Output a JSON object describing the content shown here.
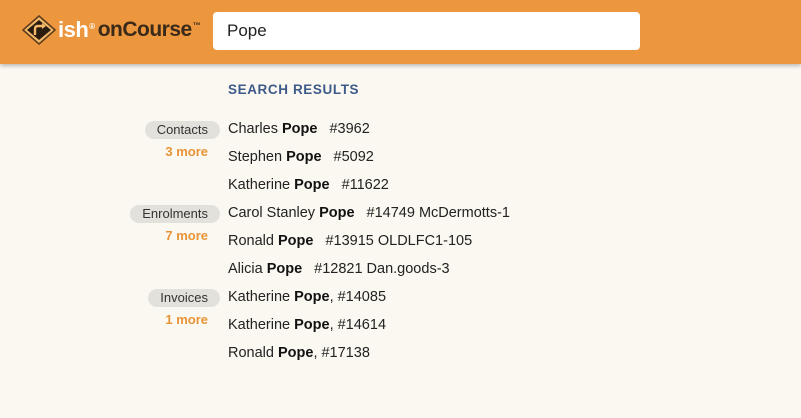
{
  "header": {
    "logo_ish": "ish",
    "logo_reg": "®",
    "logo_oncourse": "onCourse",
    "logo_tm": "™",
    "search_value": "Pope"
  },
  "results_heading": "SEARCH RESULTS",
  "groups": [
    {
      "label": "Contacts",
      "more": "3 more",
      "items": [
        {
          "pre": "Charles ",
          "match": "Pope",
          "post": "",
          "id": "#3962"
        },
        {
          "pre": "Stephen ",
          "match": "Pope",
          "post": "",
          "id": "#5092"
        },
        {
          "pre": "Katherine ",
          "match": "Pope",
          "post": "",
          "id": "#11622"
        }
      ]
    },
    {
      "label": "Enrolments",
      "more": "7 more",
      "items": [
        {
          "pre": "Carol Stanley ",
          "match": "Pope",
          "post": "",
          "id": "#14749 McDermotts-1"
        },
        {
          "pre": "Ronald ",
          "match": "Pope",
          "post": "",
          "id": "#13915 OLDLFC1-105"
        },
        {
          "pre": "Alicia ",
          "match": "Pope",
          "post": "",
          "id": "#12821 Dan.goods-3"
        }
      ]
    },
    {
      "label": "Invoices",
      "more": "1 more",
      "items": [
        {
          "pre": "Katherine ",
          "match": "Pope",
          "post": ", #14085",
          "id": ""
        },
        {
          "pre": "Katherine ",
          "match": "Pope",
          "post": ", #14614",
          "id": ""
        },
        {
          "pre": "Ronald ",
          "match": "Pope",
          "post": ", #17138",
          "id": ""
        }
      ]
    }
  ],
  "colors": {
    "header_bg": "#ec963e",
    "page_bg": "#fbf8f1",
    "heading": "#3d5a8a",
    "more_link": "#e89436",
    "label_pill": "#e3e1dc"
  }
}
